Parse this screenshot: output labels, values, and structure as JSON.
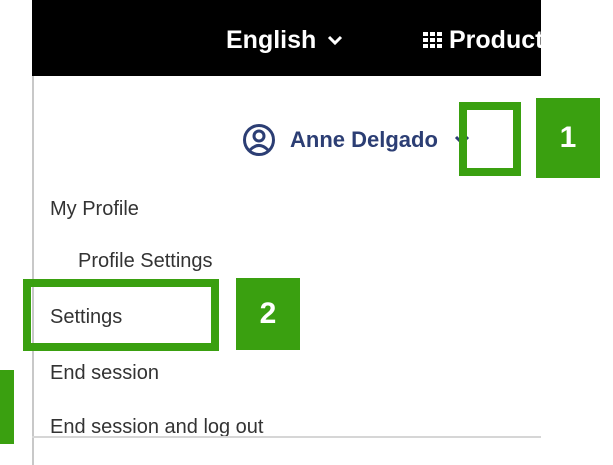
{
  "topbar": {
    "language_label": "English",
    "products_label": "Products"
  },
  "user": {
    "name": "Anne Delgado"
  },
  "menu": {
    "items": [
      {
        "label": "My Profile"
      },
      {
        "label": "Profile Settings"
      },
      {
        "label": "Settings"
      },
      {
        "label": "End session"
      },
      {
        "label": "End session and log out"
      }
    ]
  },
  "annotations": {
    "step1": "1",
    "step2": "2"
  },
  "colors": {
    "highlight": "#3aa010",
    "username": "#2c3e74",
    "topbar": "#000000"
  }
}
